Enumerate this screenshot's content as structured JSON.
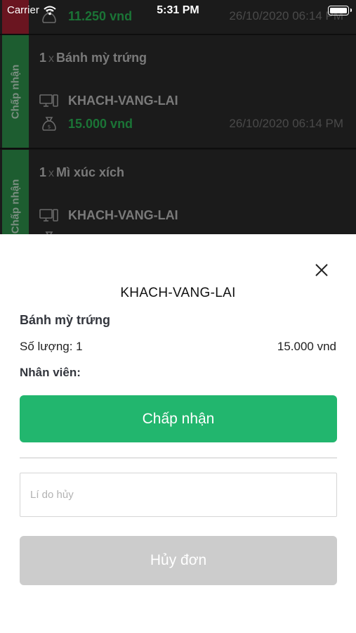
{
  "status_bar": {
    "carrier": "Carrier",
    "time": "5:31 PM"
  },
  "orders": [
    {
      "status": "",
      "quantity": "",
      "item": "",
      "customer": "",
      "price": "11.250 vnd",
      "datetime": "26/10/2020  06:14 PM"
    },
    {
      "status": "Chấp nhận",
      "quantity": "1",
      "item": "Bánh mỳ trứng",
      "customer": "KHACH-VANG-LAI",
      "price": "15.000 vnd",
      "datetime": "26/10/2020  06:14 PM"
    },
    {
      "status": "Chấp nhận",
      "quantity": "1",
      "item": "Mì xúc xích",
      "customer": "KHACH-VANG-LAI",
      "price": "",
      "datetime": ""
    }
  ],
  "sheet": {
    "title": "KHACH-VANG-LAI",
    "item_name": "Bánh mỳ trứng",
    "quantity_label": "Số lượng: 1",
    "price": "15.000 vnd",
    "staff_label": "Nhân viên:",
    "accept_label": "Chấp nhận",
    "reason_placeholder": "Lí do hủy",
    "reason_value": "",
    "cancel_label": "Hủy đơn"
  },
  "colors": {
    "accept": "#22b66e",
    "cancel_disabled": "#cccccc",
    "price_green": "#1b7436",
    "status_tag": "#1d5d30"
  }
}
